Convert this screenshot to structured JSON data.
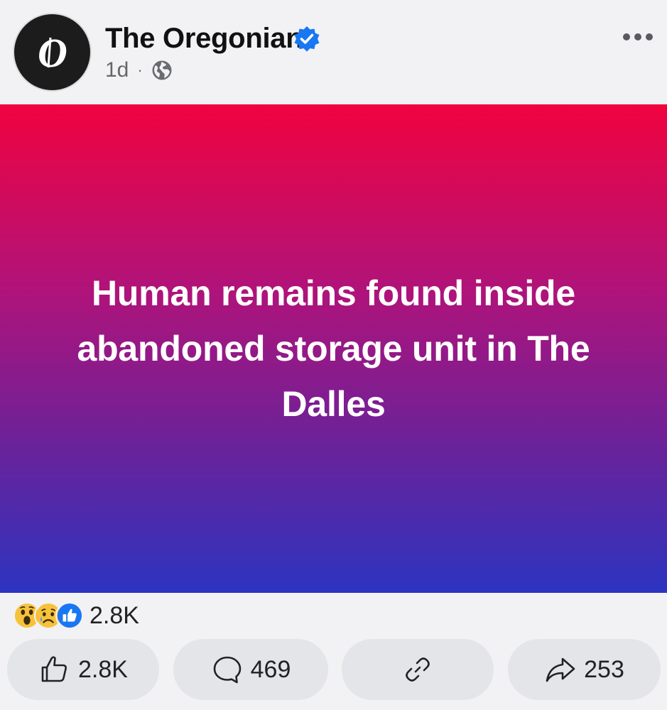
{
  "post": {
    "page_name": "The Oregonian",
    "avatar_letter": "O",
    "time_ago": "1d",
    "separator": "·",
    "audience_icon": "globe-icon",
    "verified_icon": "verified-badge-icon",
    "more_icon": "more-options-icon"
  },
  "banner": {
    "headline": "Human remains found inside abandoned storage unit in The Dalles",
    "gradient_top": "#f0033f",
    "gradient_bottom": "#2c34c0"
  },
  "reactions": {
    "icons": [
      "wow-reaction-icon",
      "sad-reaction-icon",
      "like-reaction-icon"
    ],
    "count": "2.8K"
  },
  "actions": {
    "like_count": "2.8K",
    "comment_count": "469",
    "share_count": "253"
  },
  "colors": {
    "facebook_blue": "#1877f2",
    "background": "#f2f2f4",
    "button_bg": "#e4e5e9"
  }
}
